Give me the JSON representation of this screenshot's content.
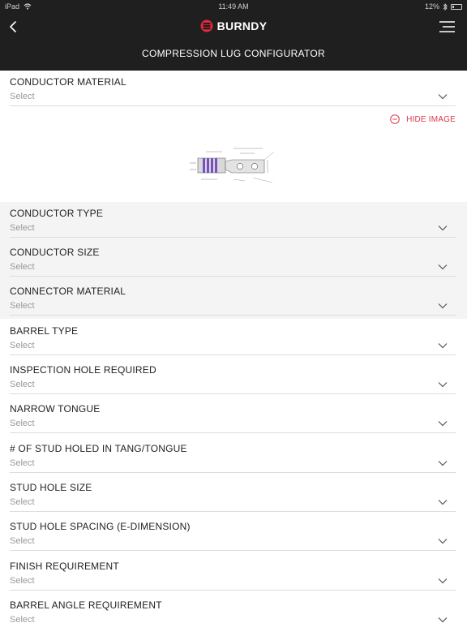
{
  "status_bar": {
    "carrier": "iPad",
    "time": "11:49 AM",
    "battery_text": "12%"
  },
  "header": {
    "brand": "BURNDY",
    "title": "COMPRESSION LUG CONFIGURATOR"
  },
  "image_toggle": {
    "label": "HIDE IMAGE"
  },
  "colors": {
    "header_bg": "#1f1f1f",
    "accent_red": "#d83a4a",
    "brand_red": "#e5273a",
    "purple": "#7a4fbf"
  },
  "fields": [
    {
      "label": "CONDUCTOR MATERIAL",
      "value": "Select"
    },
    {
      "label": "CONDUCTOR TYPE",
      "value": "Select"
    },
    {
      "label": "CONDUCTOR SIZE",
      "value": "Select"
    },
    {
      "label": "CONNECTOR MATERIAL",
      "value": "Select"
    },
    {
      "label": "BARREL TYPE",
      "value": "Select"
    },
    {
      "label": "INSPECTION HOLE REQUIRED",
      "value": "Select"
    },
    {
      "label": "NARROW TONGUE",
      "value": "Select"
    },
    {
      "label": "# OF STUD HOLED IN TANG/TONGUE",
      "value": "Select"
    },
    {
      "label": "STUD HOLE SIZE",
      "value": "Select"
    },
    {
      "label": "STUD HOLE SPACING (E-DIMENSION)",
      "value": "Select"
    },
    {
      "label": "FINISH REQUIREMENT",
      "value": "Select"
    },
    {
      "label": "BARREL ANGLE REQUIREMENT",
      "value": "Select"
    }
  ]
}
